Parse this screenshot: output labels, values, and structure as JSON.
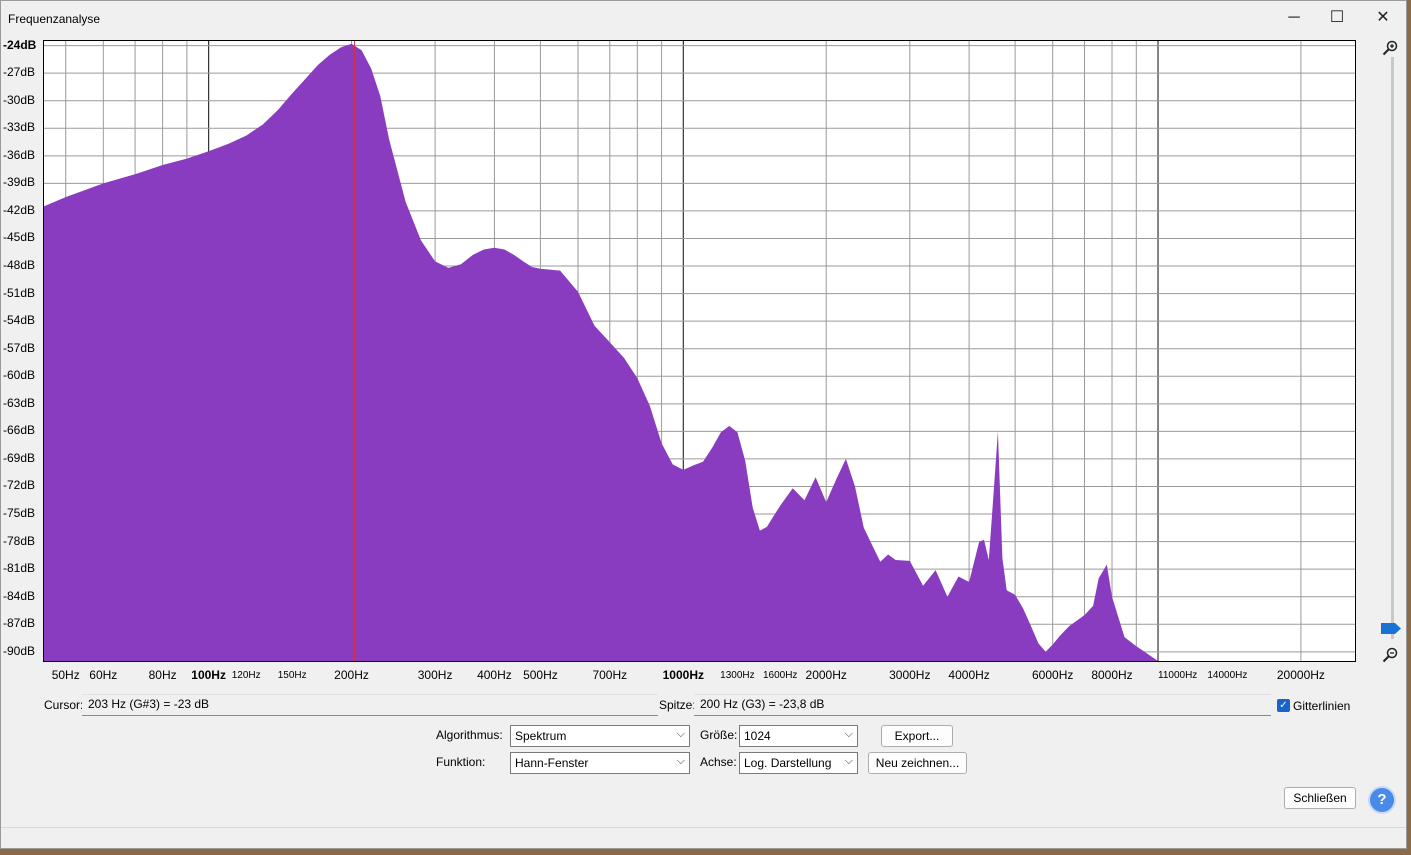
{
  "window": {
    "title": "Frequenzanalyse",
    "minimize_glyph": "─",
    "maximize_glyph": "☐",
    "close_glyph": "✕"
  },
  "chart_data": {
    "type": "area",
    "xscale": "log",
    "xlim": [
      45,
      26000
    ],
    "ylim": [
      -91,
      -23.5
    ],
    "ylabel_unit": "dB",
    "grid": true,
    "fill_color": "#8a3cc0",
    "cursor_line_hz": 203,
    "cursor_line_color": "#d83030",
    "ytick_labels": [
      "-24dB",
      "-27dB",
      "-30dB",
      "-33dB",
      "-36dB",
      "-39dB",
      "-42dB",
      "-45dB",
      "-48dB",
      "-51dB",
      "-54dB",
      "-57dB",
      "-60dB",
      "-63dB",
      "-66dB",
      "-69dB",
      "-72dB",
      "-75dB",
      "-78dB",
      "-81dB",
      "-84dB",
      "-87dB",
      "-90dB"
    ],
    "ytick_values": [
      -24,
      -27,
      -30,
      -33,
      -36,
      -39,
      -42,
      -45,
      -48,
      -51,
      -54,
      -57,
      -60,
      -63,
      -66,
      -69,
      -72,
      -75,
      -78,
      -81,
      -84,
      -87,
      -90
    ],
    "xtick_labels": [
      {
        "hz": 50,
        "text": "50Hz"
      },
      {
        "hz": 60,
        "text": "60Hz"
      },
      {
        "hz": 80,
        "text": "80Hz"
      },
      {
        "hz": 100,
        "text": "100Hz"
      },
      {
        "hz": 120,
        "text": "120Hz",
        "small": true
      },
      {
        "hz": 150,
        "text": "150Hz",
        "small": true
      },
      {
        "hz": 200,
        "text": "200Hz"
      },
      {
        "hz": 300,
        "text": "300Hz"
      },
      {
        "hz": 400,
        "text": "400Hz"
      },
      {
        "hz": 500,
        "text": "500Hz"
      },
      {
        "hz": 700,
        "text": "700Hz"
      },
      {
        "hz": 1000,
        "text": "1000Hz"
      },
      {
        "hz": 1300,
        "text": "1300Hz",
        "small": true
      },
      {
        "hz": 1600,
        "text": "1600Hz",
        "small": true
      },
      {
        "hz": 2000,
        "text": "2000Hz"
      },
      {
        "hz": 3000,
        "text": "3000Hz"
      },
      {
        "hz": 4000,
        "text": "4000Hz"
      },
      {
        "hz": 6000,
        "text": "6000Hz"
      },
      {
        "hz": 8000,
        "text": "8000Hz"
      },
      {
        "hz": 11000,
        "text": "11000Hz",
        "small": true
      },
      {
        "hz": 14000,
        "text": "14000Hz",
        "small": true
      },
      {
        "hz": 20000,
        "text": "20000Hz"
      }
    ],
    "x": [
      45,
      50,
      60,
      70,
      80,
      90,
      100,
      110,
      120,
      130,
      140,
      150,
      160,
      170,
      180,
      190,
      200,
      210,
      220,
      230,
      240,
      260,
      280,
      300,
      320,
      340,
      360,
      380,
      400,
      420,
      440,
      460,
      480,
      500,
      550,
      600,
      650,
      700,
      750,
      800,
      850,
      900,
      950,
      1000,
      1050,
      1100,
      1150,
      1200,
      1250,
      1300,
      1350,
      1400,
      1450,
      1500,
      1550,
      1600,
      1700,
      1800,
      1900,
      2000,
      2100,
      2200,
      2300,
      2400,
      2500,
      2600,
      2700,
      2800,
      3000,
      3200,
      3400,
      3600,
      3800,
      4000,
      4200,
      4300,
      4400,
      4500,
      4600,
      4700,
      4800,
      5000,
      5200,
      5400,
      5600,
      5800,
      6000,
      6200,
      6500,
      7000,
      7300,
      7500,
      7800,
      8000,
      8500,
      9000,
      9500,
      10000,
      11000,
      12000,
      13000,
      14000,
      16000,
      20000
    ],
    "values": [
      -41.5,
      -40.5,
      -39,
      -38,
      -37,
      -36.3,
      -35.5,
      -34.7,
      -33.8,
      -32.6,
      -31,
      -29.2,
      -27.6,
      -26.1,
      -25,
      -24.2,
      -23.8,
      -24.5,
      -26.5,
      -29.5,
      -34.2,
      -41,
      -45.2,
      -47.5,
      -48.2,
      -47.8,
      -46.8,
      -46.2,
      -46,
      -46.2,
      -46.8,
      -47.5,
      -48.1,
      -48.3,
      -48.5,
      -50.8,
      -54.5,
      -56.3,
      -58,
      -60.2,
      -63.2,
      -67.3,
      -69.6,
      -70.2,
      -69.7,
      -69.3,
      -67.8,
      -66.1,
      -65.4,
      -66.1,
      -69.2,
      -74.3,
      -76.8,
      -76.4,
      -75.2,
      -74.1,
      -72.2,
      -73.5,
      -71,
      -73.7,
      -71.2,
      -69,
      -72,
      -76.5,
      -78.4,
      -80.2,
      -79.4,
      -80,
      -80.1,
      -82.8,
      -81.1,
      -84,
      -81.8,
      -82.4,
      -78,
      -77.8,
      -80,
      -73,
      -66,
      -79.8,
      -83.3,
      -83.8,
      -85.3,
      -87.2,
      -89.1,
      -90,
      -89.2,
      -88.3,
      -87.2,
      -86,
      -85,
      -82,
      -80.5,
      -84,
      -88.4,
      -89.4,
      -90.2,
      -91,
      -91,
      -91,
      -91,
      -91,
      -91,
      -91
    ]
  },
  "readouts": {
    "cursor_label": "Cursor:",
    "cursor_value": "203 Hz (G#3) = -23 dB",
    "peak_label": "Spitze:",
    "peak_value": "200 Hz (G3) = -23,8 dB",
    "grid_label": "Gitterlinien",
    "grid_checked": true
  },
  "controls": {
    "algorithm_label": "Algorithmus:",
    "algorithm_value": "Spektrum",
    "function_label": "Funktion:",
    "function_value": "Hann-Fenster",
    "size_label": "Größe:",
    "size_value": "1024",
    "axis_label": "Achse:",
    "axis_value": "Log. Darstellung",
    "export_label": "Export...",
    "redraw_label": "Neu zeichnen...",
    "close_label": "Schließen",
    "help_glyph": "?"
  },
  "colors": {
    "accent": "#1a73d4",
    "spectrum": "#8a3cc0"
  }
}
